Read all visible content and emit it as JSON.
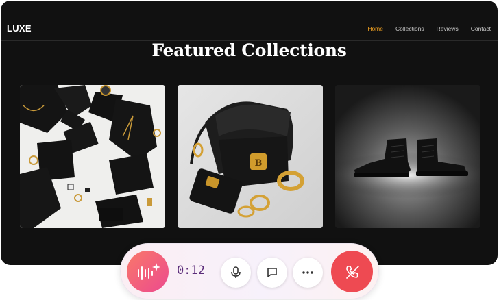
{
  "brand": {
    "logo": "LUXE"
  },
  "nav": {
    "links": [
      {
        "label": "Home",
        "active": true
      },
      {
        "label": "Collections",
        "active": false
      },
      {
        "label": "Reviews",
        "active": false
      },
      {
        "label": "Contact",
        "active": false
      }
    ]
  },
  "main": {
    "heading": "Featured Collections"
  },
  "colors": {
    "background": "#111111",
    "accent": "#f0a020",
    "end_call": "#ee4a52",
    "ai_gradient_start": "#f9786a",
    "ai_gradient_end": "#ec4a8e"
  },
  "call_bar": {
    "timer": "0:12",
    "icons": [
      "ai-voice-icon",
      "microphone-icon",
      "chat-bubble-icon",
      "more-icon",
      "end-call-icon"
    ]
  }
}
